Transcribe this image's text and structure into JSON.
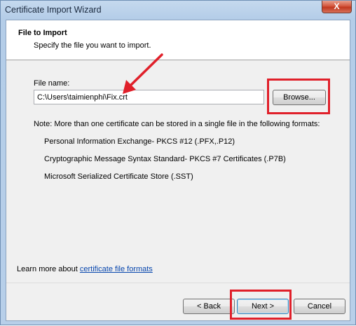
{
  "window": {
    "title": "Certificate Import Wizard",
    "close_glyph": "X"
  },
  "header": {
    "title": "File to Import",
    "subtitle": "Specify the file you want to import."
  },
  "file_name": {
    "label": "File name:",
    "value": "C:\\Users\\taimienphi\\Fix.crt"
  },
  "browse_label": "Browse...",
  "note": "Note:  More than one certificate can be stored in a single file in the following formats:",
  "formats": [
    "Personal Information Exchange- PKCS #12 (.PFX,.P12)",
    "Cryptographic Message Syntax Standard- PKCS #7 Certificates (.P7B)",
    "Microsoft Serialized Certificate Store (.SST)"
  ],
  "learn_more": {
    "prefix": "Learn more about ",
    "link": "certificate file formats"
  },
  "buttons": {
    "back": "< Back",
    "next": "Next >",
    "cancel": "Cancel"
  },
  "annotation_color": "#e0202a"
}
